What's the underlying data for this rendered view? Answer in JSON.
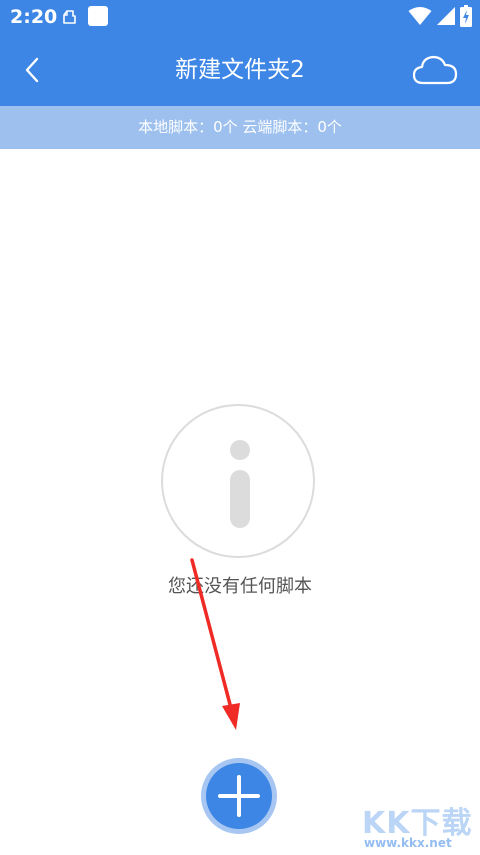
{
  "status_bar": {
    "time": "2:20",
    "icons": [
      "notification-icon",
      "square-app-icon",
      "wifi-icon",
      "signal-icon",
      "battery-icon"
    ]
  },
  "header": {
    "title": "新建文件夹2",
    "back_icon": "chevron-left-icon",
    "cloud_icon": "cloud-icon"
  },
  "info_strip": {
    "text": "本地脚本：0个 云端脚本：0个"
  },
  "empty_state": {
    "icon": "info-icon",
    "message": "您还没有任何脚本"
  },
  "fab": {
    "icon": "plus-icon"
  },
  "watermark": {
    "logo": "KK下载",
    "url": "www.kkx.net"
  },
  "colors": {
    "primary": "#3d86e6",
    "strip": "#9dc0ee",
    "empty_gray": "#dcdcdc",
    "arrow": "#f02a24"
  }
}
